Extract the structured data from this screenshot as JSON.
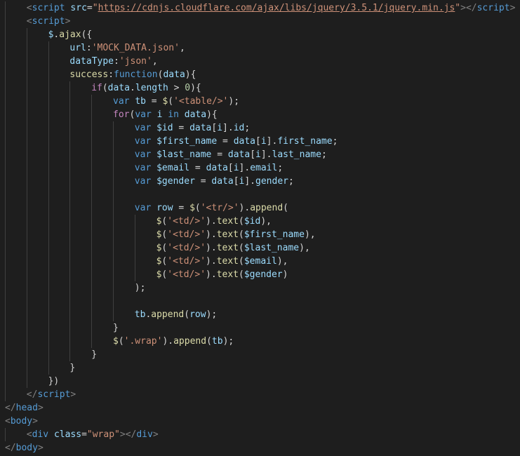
{
  "editor": {
    "lines": [
      {
        "indent": 1,
        "tokens": [
          [
            "punc",
            "<"
          ],
          [
            "tag",
            "script"
          ],
          [
            "text",
            " "
          ],
          [
            "attr",
            "src"
          ],
          [
            "text",
            "="
          ],
          [
            "str",
            "\""
          ],
          [
            "url",
            "https://cdnjs.cloudflare.com/ajax/libs/jquery/3.5.1/jquery.min.js"
          ],
          [
            "str",
            "\""
          ],
          [
            "punc",
            "></"
          ],
          [
            "tag",
            "script"
          ],
          [
            "punc",
            ">"
          ]
        ]
      },
      {
        "indent": 1,
        "tokens": [
          [
            "punc",
            "<"
          ],
          [
            "tag",
            "script"
          ],
          [
            "punc",
            ">"
          ]
        ]
      },
      {
        "indent": 2,
        "tokens": [
          [
            "var",
            "$"
          ],
          [
            "text",
            "."
          ],
          [
            "fn",
            "ajax"
          ],
          [
            "text",
            "({"
          ]
        ]
      },
      {
        "indent": 3,
        "tokens": [
          [
            "var",
            "url"
          ],
          [
            "text",
            ":"
          ],
          [
            "str",
            "'MOCK_DATA.json'"
          ],
          [
            "text",
            ","
          ]
        ]
      },
      {
        "indent": 3,
        "tokens": [
          [
            "var",
            "dataType"
          ],
          [
            "text",
            ":"
          ],
          [
            "str",
            "'json'"
          ],
          [
            "text",
            ","
          ]
        ]
      },
      {
        "indent": 3,
        "tokens": [
          [
            "fn",
            "success"
          ],
          [
            "text",
            ":"
          ],
          [
            "kw",
            "function"
          ],
          [
            "text",
            "("
          ],
          [
            "var",
            "data"
          ],
          [
            "text",
            "){"
          ]
        ]
      },
      {
        "indent": 4,
        "tokens": [
          [
            "ctrl",
            "if"
          ],
          [
            "text",
            "("
          ],
          [
            "var",
            "data"
          ],
          [
            "text",
            "."
          ],
          [
            "var",
            "length"
          ],
          [
            "text",
            " > "
          ],
          [
            "num",
            "0"
          ],
          [
            "text",
            "){"
          ]
        ]
      },
      {
        "indent": 5,
        "tokens": [
          [
            "kw",
            "var"
          ],
          [
            "text",
            " "
          ],
          [
            "var",
            "tb"
          ],
          [
            "text",
            " = "
          ],
          [
            "fn",
            "$"
          ],
          [
            "text",
            "("
          ],
          [
            "str",
            "'<table/>'"
          ],
          [
            "text",
            ");"
          ]
        ]
      },
      {
        "indent": 5,
        "tokens": [
          [
            "ctrl",
            "for"
          ],
          [
            "text",
            "("
          ],
          [
            "kw",
            "var"
          ],
          [
            "text",
            " "
          ],
          [
            "var",
            "i"
          ],
          [
            "text",
            " "
          ],
          [
            "kw",
            "in"
          ],
          [
            "text",
            " "
          ],
          [
            "var",
            "data"
          ],
          [
            "text",
            "){"
          ]
        ]
      },
      {
        "indent": 6,
        "tokens": [
          [
            "kw",
            "var"
          ],
          [
            "text",
            " "
          ],
          [
            "var",
            "$id"
          ],
          [
            "text",
            " = "
          ],
          [
            "var",
            "data"
          ],
          [
            "text",
            "["
          ],
          [
            "var",
            "i"
          ],
          [
            "text",
            "]."
          ],
          [
            "var",
            "id"
          ],
          [
            "text",
            ";"
          ]
        ]
      },
      {
        "indent": 6,
        "tokens": [
          [
            "kw",
            "var"
          ],
          [
            "text",
            " "
          ],
          [
            "var",
            "$first_name"
          ],
          [
            "text",
            " = "
          ],
          [
            "var",
            "data"
          ],
          [
            "text",
            "["
          ],
          [
            "var",
            "i"
          ],
          [
            "text",
            "]."
          ],
          [
            "var",
            "first_name"
          ],
          [
            "text",
            ";"
          ]
        ]
      },
      {
        "indent": 6,
        "tokens": [
          [
            "kw",
            "var"
          ],
          [
            "text",
            " "
          ],
          [
            "var",
            "$last_name"
          ],
          [
            "text",
            " = "
          ],
          [
            "var",
            "data"
          ],
          [
            "text",
            "["
          ],
          [
            "var",
            "i"
          ],
          [
            "text",
            "]."
          ],
          [
            "var",
            "last_name"
          ],
          [
            "text",
            ";"
          ]
        ]
      },
      {
        "indent": 6,
        "tokens": [
          [
            "kw",
            "var"
          ],
          [
            "text",
            " "
          ],
          [
            "var",
            "$email"
          ],
          [
            "text",
            " = "
          ],
          [
            "var",
            "data"
          ],
          [
            "text",
            "["
          ],
          [
            "var",
            "i"
          ],
          [
            "text",
            "]."
          ],
          [
            "var",
            "email"
          ],
          [
            "text",
            ";"
          ]
        ]
      },
      {
        "indent": 6,
        "tokens": [
          [
            "kw",
            "var"
          ],
          [
            "text",
            " "
          ],
          [
            "var",
            "$gender"
          ],
          [
            "text",
            " = "
          ],
          [
            "var",
            "data"
          ],
          [
            "text",
            "["
          ],
          [
            "var",
            "i"
          ],
          [
            "text",
            "]."
          ],
          [
            "var",
            "gender"
          ],
          [
            "text",
            ";"
          ]
        ]
      },
      {
        "indent": 6,
        "tokens": []
      },
      {
        "indent": 6,
        "tokens": [
          [
            "kw",
            "var"
          ],
          [
            "text",
            " "
          ],
          [
            "var",
            "row"
          ],
          [
            "text",
            " = "
          ],
          [
            "fn",
            "$"
          ],
          [
            "text",
            "("
          ],
          [
            "str",
            "'<tr/>'"
          ],
          [
            "text",
            ")."
          ],
          [
            "fn",
            "append"
          ],
          [
            "text",
            "("
          ]
        ]
      },
      {
        "indent": 7,
        "tokens": [
          [
            "fn",
            "$"
          ],
          [
            "text",
            "("
          ],
          [
            "str",
            "'<td/>'"
          ],
          [
            "text",
            ")."
          ],
          [
            "fn",
            "text"
          ],
          [
            "text",
            "("
          ],
          [
            "var",
            "$id"
          ],
          [
            "text",
            "),"
          ]
        ]
      },
      {
        "indent": 7,
        "tokens": [
          [
            "fn",
            "$"
          ],
          [
            "text",
            "("
          ],
          [
            "str",
            "'<td/>'"
          ],
          [
            "text",
            ")."
          ],
          [
            "fn",
            "text"
          ],
          [
            "text",
            "("
          ],
          [
            "var",
            "$first_name"
          ],
          [
            "text",
            "),"
          ]
        ]
      },
      {
        "indent": 7,
        "tokens": [
          [
            "fn",
            "$"
          ],
          [
            "text",
            "("
          ],
          [
            "str",
            "'<td/>'"
          ],
          [
            "text",
            ")."
          ],
          [
            "fn",
            "text"
          ],
          [
            "text",
            "("
          ],
          [
            "var",
            "$last_name"
          ],
          [
            "text",
            "),"
          ]
        ]
      },
      {
        "indent": 7,
        "tokens": [
          [
            "fn",
            "$"
          ],
          [
            "text",
            "("
          ],
          [
            "str",
            "'<td/>'"
          ],
          [
            "text",
            ")."
          ],
          [
            "fn",
            "text"
          ],
          [
            "text",
            "("
          ],
          [
            "var",
            "$email"
          ],
          [
            "text",
            "),"
          ]
        ]
      },
      {
        "indent": 7,
        "tokens": [
          [
            "fn",
            "$"
          ],
          [
            "text",
            "("
          ],
          [
            "str",
            "'<td/>'"
          ],
          [
            "text",
            ")."
          ],
          [
            "fn",
            "text"
          ],
          [
            "text",
            "("
          ],
          [
            "var",
            "$gender"
          ],
          [
            "text",
            ")"
          ]
        ]
      },
      {
        "indent": 6,
        "tokens": [
          [
            "text",
            ");"
          ]
        ]
      },
      {
        "indent": 6,
        "tokens": []
      },
      {
        "indent": 6,
        "tokens": [
          [
            "var",
            "tb"
          ],
          [
            "text",
            "."
          ],
          [
            "fn",
            "append"
          ],
          [
            "text",
            "("
          ],
          [
            "var",
            "row"
          ],
          [
            "text",
            ");"
          ]
        ]
      },
      {
        "indent": 5,
        "tokens": [
          [
            "text",
            "}"
          ]
        ]
      },
      {
        "indent": 5,
        "tokens": [
          [
            "fn",
            "$"
          ],
          [
            "text",
            "("
          ],
          [
            "str",
            "'.wrap'"
          ],
          [
            "text",
            ")."
          ],
          [
            "fn",
            "append"
          ],
          [
            "text",
            "("
          ],
          [
            "var",
            "tb"
          ],
          [
            "text",
            ");"
          ]
        ]
      },
      {
        "indent": 4,
        "tokens": [
          [
            "text",
            "}"
          ]
        ]
      },
      {
        "indent": 3,
        "tokens": [
          [
            "text",
            "}"
          ]
        ]
      },
      {
        "indent": 2,
        "tokens": [
          [
            "text",
            "})"
          ]
        ]
      },
      {
        "indent": 1,
        "tokens": [
          [
            "punc",
            "</"
          ],
          [
            "tag",
            "script"
          ],
          [
            "punc",
            ">"
          ]
        ]
      },
      {
        "indent": 0,
        "tokens": [
          [
            "punc",
            "</"
          ],
          [
            "tag",
            "head"
          ],
          [
            "punc",
            ">"
          ]
        ]
      },
      {
        "indent": 0,
        "tokens": [
          [
            "punc",
            "<"
          ],
          [
            "tag",
            "body"
          ],
          [
            "punc",
            ">"
          ]
        ]
      },
      {
        "indent": 1,
        "tokens": [
          [
            "punc",
            "<"
          ],
          [
            "tag",
            "div"
          ],
          [
            "text",
            " "
          ],
          [
            "attr",
            "class"
          ],
          [
            "text",
            "="
          ],
          [
            "str",
            "\"wrap\""
          ],
          [
            "punc",
            "></"
          ],
          [
            "tag",
            "div"
          ],
          [
            "punc",
            ">"
          ]
        ]
      },
      {
        "indent": 0,
        "tokens": [
          [
            "punc",
            "</"
          ],
          [
            "tag",
            "body"
          ],
          [
            "punc",
            ">"
          ]
        ]
      }
    ]
  }
}
